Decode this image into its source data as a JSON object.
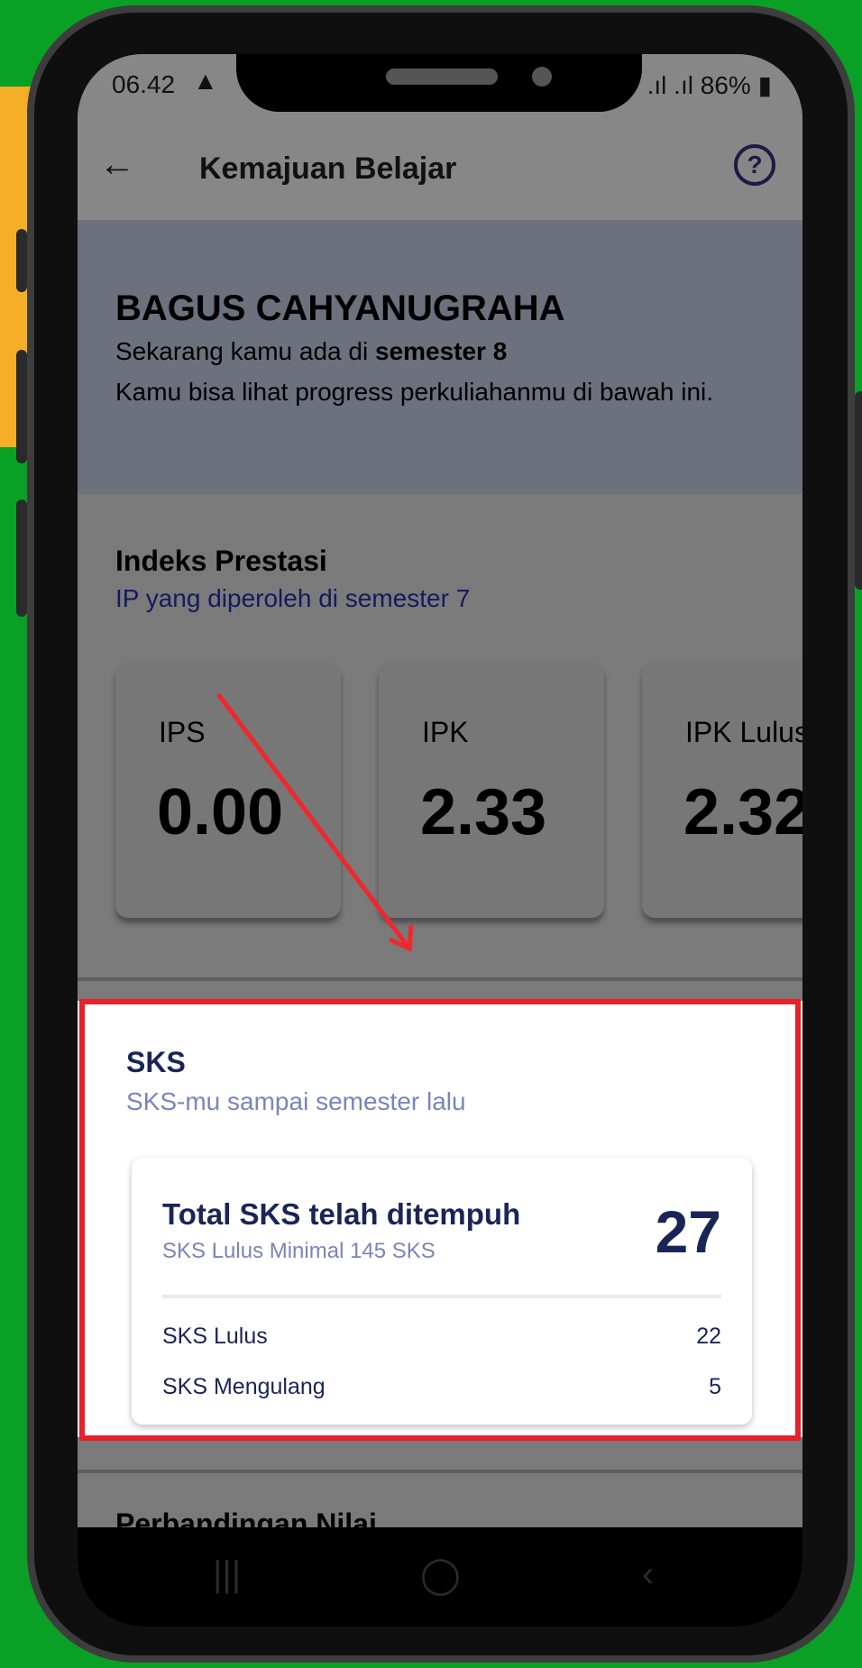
{
  "status": {
    "time": "06.42",
    "warning_icon": "warning-icon",
    "signal": ".ıl .ıl",
    "battery": "86%"
  },
  "app_bar": {
    "title": "Kemajuan Belajar",
    "back_icon": "back-arrow-icon",
    "help_icon": "help-circle-icon",
    "help_glyph": "?"
  },
  "profile": {
    "name": "BAGUS CAHYANUGRAHA",
    "semester_prefix": "Sekarang kamu ada di ",
    "semester_value": "semester 8",
    "description": "Kamu bisa lihat progress perkuliahanmu di bawah ini."
  },
  "ip": {
    "title": "Indeks Prestasi",
    "subtitle": "IP yang diperoleh di semester 7",
    "cards": [
      {
        "label": "IPS",
        "value": "0.00"
      },
      {
        "label": "IPK",
        "value": "2.33"
      },
      {
        "label": "IPK Lulus",
        "value": "2.32"
      }
    ]
  },
  "sks": {
    "title": "SKS",
    "subtitle": "SKS-mu sampai semester lalu",
    "card_title": "Total SKS telah ditempuh",
    "card_min": "SKS Lulus Minimal 145 SKS",
    "total": "27",
    "rows": [
      {
        "label": "SKS Lulus",
        "value": "22"
      },
      {
        "label": "SKS Mengulang",
        "value": "5"
      }
    ]
  },
  "next_section": {
    "title": "Perbandingan Nilai"
  },
  "nav": {
    "recent": "|||",
    "home": "◯",
    "back": "‹"
  },
  "colors": {
    "highlight": "#e8202a",
    "annotation_arrow": "#f0272c",
    "primary_text": "#1a2557",
    "secondary_text": "#7b84b8",
    "background_green": "#0aa025",
    "accent_yellow": "#f6ad27"
  }
}
